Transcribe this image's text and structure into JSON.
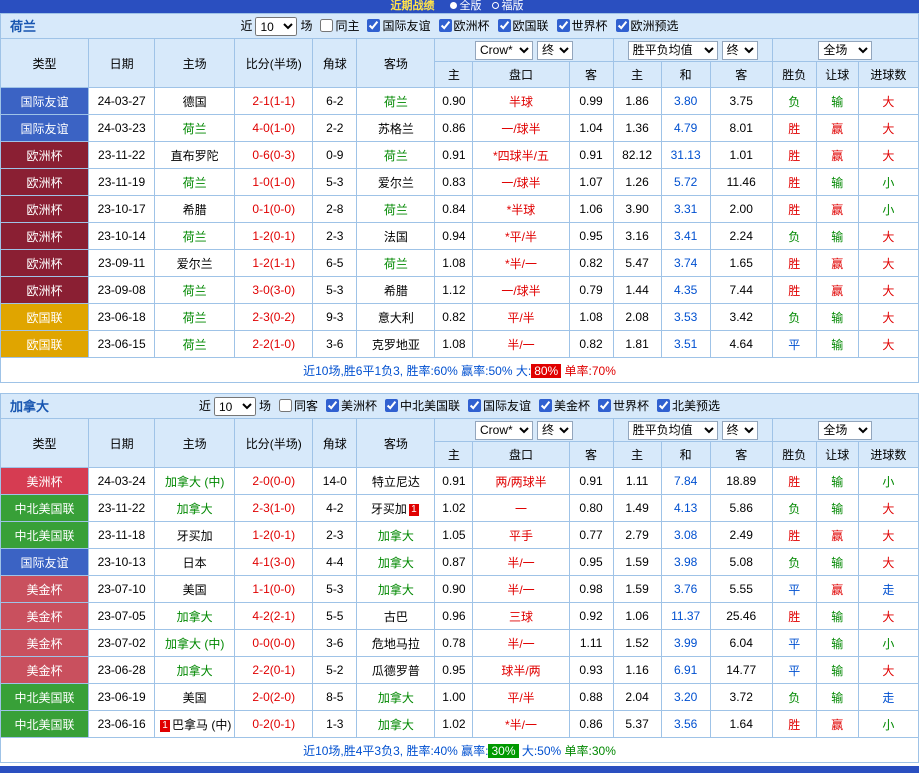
{
  "topbar": {
    "title": "近期战绩",
    "options": [
      {
        "label": "全版",
        "selected": true
      },
      {
        "label": "福版",
        "selected": false
      }
    ]
  },
  "table_head": {
    "type": "类型",
    "date": "日期",
    "home": "主场",
    "score": "比分(半场)",
    "corner": "角球",
    "away": "客场",
    "odds_company": "Crow*",
    "final": "终",
    "avg": "胜平负均值",
    "scope": "全场",
    "sub": [
      "主",
      "盘口",
      "客",
      "主",
      "和",
      "客",
      "胜负",
      "让球",
      "进球数"
    ]
  },
  "type_colors": {
    "国际友谊": "#3b63c4",
    "欧洲杯": "#8a1f33",
    "欧国联": "#e0a500",
    "美洲杯": "#d63c52",
    "中北美国联": "#38a038",
    "美金杯": "#c9505e"
  },
  "sections": [
    {
      "team": "荷兰",
      "filter": {
        "near": "近",
        "count": "10",
        "games": "场",
        "same": {
          "label": "同主",
          "checked": false
        },
        "leagues": [
          {
            "label": "国际友谊",
            "checked": true
          },
          {
            "label": "欧洲杯",
            "checked": true
          },
          {
            "label": "欧国联",
            "checked": true
          },
          {
            "label": "世界杯",
            "checked": true
          },
          {
            "label": "欧洲预选",
            "checked": true
          }
        ]
      },
      "rows": [
        {
          "type": "国际友谊",
          "date": "24-03-27",
          "home": "德国",
          "score": "2-1(1-1)",
          "corner": "6-2",
          "away": "荷兰",
          "away_g": true,
          "o1": "0.90",
          "pan": "半球",
          "o2": "0.99",
          "a1": "1.86",
          "ad": "3.80",
          "a2": "3.75",
          "res": "负",
          "res_c": "g",
          "let": "输",
          "let_c": "g",
          "goal": "大",
          "goal_c": "r"
        },
        {
          "type": "国际友谊",
          "date": "24-03-23",
          "home": "荷兰",
          "home_g": true,
          "score": "4-0(1-0)",
          "corner": "2-2",
          "away": "苏格兰",
          "o1": "0.86",
          "pan": "一/球半",
          "o2": "1.04",
          "a1": "1.36",
          "ad": "4.79",
          "a2": "8.01",
          "res": "胜",
          "res_c": "r",
          "let": "赢",
          "let_c": "r",
          "goal": "大",
          "goal_c": "r"
        },
        {
          "type": "欧洲杯",
          "date": "23-11-22",
          "home": "直布罗陀",
          "score": "0-6(0-3)",
          "corner": "0-9",
          "away": "荷兰",
          "away_g": true,
          "o1": "0.91",
          "pan": "*四球半/五",
          "o2": "0.91",
          "a1": "82.12",
          "ad": "31.13",
          "a2": "1.01",
          "res": "胜",
          "res_c": "r",
          "let": "赢",
          "let_c": "r",
          "goal": "大",
          "goal_c": "r"
        },
        {
          "type": "欧洲杯",
          "date": "23-11-19",
          "home": "荷兰",
          "home_g": true,
          "score": "1-0(1-0)",
          "corner": "5-3",
          "away": "爱尔兰",
          "o1": "0.83",
          "pan": "一/球半",
          "o2": "1.07",
          "a1": "1.26",
          "ad": "5.72",
          "a2": "11.46",
          "res": "胜",
          "res_c": "r",
          "let": "输",
          "let_c": "g",
          "goal": "小",
          "goal_c": "g"
        },
        {
          "type": "欧洲杯",
          "date": "23-10-17",
          "home": "希腊",
          "score": "0-1(0-0)",
          "corner": "2-8",
          "away": "荷兰",
          "away_g": true,
          "o1": "0.84",
          "pan": "*半球",
          "o2": "1.06",
          "a1": "3.90",
          "ad": "3.31",
          "a2": "2.00",
          "res": "胜",
          "res_c": "r",
          "let": "赢",
          "let_c": "r",
          "goal": "小",
          "goal_c": "g"
        },
        {
          "type": "欧洲杯",
          "date": "23-10-14",
          "home": "荷兰",
          "home_g": true,
          "score": "1-2(0-1)",
          "corner": "2-3",
          "away": "法国",
          "o1": "0.94",
          "pan": "*平/半",
          "o2": "0.95",
          "a1": "3.16",
          "ad": "3.41",
          "a2": "2.24",
          "res": "负",
          "res_c": "g",
          "let": "输",
          "let_c": "g",
          "goal": "大",
          "goal_c": "r"
        },
        {
          "type": "欧洲杯",
          "date": "23-09-11",
          "home": "爱尔兰",
          "score": "1-2(1-1)",
          "corner": "6-5",
          "away": "荷兰",
          "away_g": true,
          "o1": "1.08",
          "pan": "*半/一",
          "o2": "0.82",
          "a1": "5.47",
          "ad": "3.74",
          "a2": "1.65",
          "res": "胜",
          "res_c": "r",
          "let": "赢",
          "let_c": "r",
          "goal": "大",
          "goal_c": "r"
        },
        {
          "type": "欧洲杯",
          "date": "23-09-08",
          "home": "荷兰",
          "home_g": true,
          "score": "3-0(3-0)",
          "corner": "5-3",
          "away": "希腊",
          "o1": "1.12",
          "pan": "一/球半",
          "o2": "0.79",
          "a1": "1.44",
          "ad": "4.35",
          "a2": "7.44",
          "res": "胜",
          "res_c": "r",
          "let": "赢",
          "let_c": "r",
          "goal": "大",
          "goal_c": "r"
        },
        {
          "type": "欧国联",
          "date": "23-06-18",
          "home": "荷兰",
          "home_g": true,
          "score": "2-3(0-2)",
          "corner": "9-3",
          "away": "意大利",
          "o1": "0.82",
          "pan": "平/半",
          "o2": "1.08",
          "a1": "2.08",
          "ad": "3.53",
          "a2": "3.42",
          "res": "负",
          "res_c": "g",
          "let": "输",
          "let_c": "g",
          "goal": "大",
          "goal_c": "r"
        },
        {
          "type": "欧国联",
          "date": "23-06-15",
          "home": "荷兰",
          "home_g": true,
          "score": "2-2(1-0)",
          "corner": "3-6",
          "away": "克罗地亚",
          "o1": "1.08",
          "pan": "半/一",
          "o2": "0.82",
          "a1": "1.81",
          "ad": "3.51",
          "a2": "4.64",
          "res": "平",
          "res_c": "b",
          "let": "输",
          "let_c": "g",
          "goal": "大",
          "goal_c": "r"
        }
      ],
      "summary": [
        {
          "t": "近10场,胜6平1负3, 胜率:60% ",
          "c": "b"
        },
        {
          "t": "赢率:50% ",
          "c": "b"
        },
        {
          "t": "大:",
          "c": "b"
        },
        {
          "t": "80%",
          "c": "hlr"
        },
        {
          "t": " 单率:70%",
          "c": "r"
        }
      ]
    },
    {
      "team": "加拿大",
      "filter": {
        "near": "近",
        "count": "10",
        "games": "场",
        "same": {
          "label": "同客",
          "checked": false
        },
        "leagues": [
          {
            "label": "美洲杯",
            "checked": true
          },
          {
            "label": "中北美国联",
            "checked": true
          },
          {
            "label": "国际友谊",
            "checked": true
          },
          {
            "label": "美金杯",
            "checked": true
          },
          {
            "label": "世界杯",
            "checked": true
          },
          {
            "label": "北美预选",
            "checked": true
          }
        ]
      },
      "rows": [
        {
          "type": "美洲杯",
          "date": "24-03-24",
          "home": "加拿大 (中)",
          "home_g": true,
          "score": "2-0(0-0)",
          "corner": "14-0",
          "away": "特立尼达",
          "o1": "0.91",
          "pan": "两/两球半",
          "o2": "0.91",
          "a1": "1.11",
          "ad": "7.84",
          "a2": "18.89",
          "res": "胜",
          "res_c": "r",
          "let": "输",
          "let_c": "g",
          "goal": "小",
          "goal_c": "g"
        },
        {
          "type": "中北美国联",
          "date": "23-11-22",
          "home": "加拿大",
          "home_g": true,
          "score": "2-3(1-0)",
          "corner": "4-2",
          "away": "牙买加",
          "away_bpost": "1",
          "o1": "1.02",
          "pan": "一",
          "o2": "0.80",
          "a1": "1.49",
          "ad": "4.13",
          "a2": "5.86",
          "res": "负",
          "res_c": "g",
          "let": "输",
          "let_c": "g",
          "goal": "大",
          "goal_c": "r"
        },
        {
          "type": "中北美国联",
          "date": "23-11-18",
          "home": "牙买加",
          "score": "1-2(0-1)",
          "corner": "2-3",
          "away": "加拿大",
          "away_g": true,
          "o1": "1.05",
          "pan": "平手",
          "o2": "0.77",
          "a1": "2.79",
          "ad": "3.08",
          "a2": "2.49",
          "res": "胜",
          "res_c": "r",
          "let": "赢",
          "let_c": "r",
          "goal": "大",
          "goal_c": "r"
        },
        {
          "type": "国际友谊",
          "date": "23-10-13",
          "home": "日本",
          "score": "4-1(3-0)",
          "corner": "4-4",
          "away": "加拿大",
          "away_g": true,
          "o1": "0.87",
          "pan": "半/一",
          "o2": "0.95",
          "a1": "1.59",
          "ad": "3.98",
          "a2": "5.08",
          "res": "负",
          "res_c": "g",
          "let": "输",
          "let_c": "g",
          "goal": "大",
          "goal_c": "r"
        },
        {
          "type": "美金杯",
          "date": "23-07-10",
          "home": "美国",
          "score": "1-1(0-0)",
          "corner": "5-3",
          "away": "加拿大",
          "away_g": true,
          "o1": "0.90",
          "pan": "半/一",
          "o2": "0.98",
          "a1": "1.59",
          "ad": "3.76",
          "a2": "5.55",
          "res": "平",
          "res_c": "b",
          "let": "赢",
          "let_c": "r",
          "goal": "走",
          "goal_c": "b"
        },
        {
          "type": "美金杯",
          "date": "23-07-05",
          "home": "加拿大",
          "home_g": true,
          "score": "4-2(2-1)",
          "corner": "5-5",
          "away": "古巴",
          "o1": "0.96",
          "pan": "三球",
          "o2": "0.92",
          "a1": "1.06",
          "ad": "11.37",
          "a2": "25.46",
          "res": "胜",
          "res_c": "r",
          "let": "输",
          "let_c": "g",
          "goal": "大",
          "goal_c": "r"
        },
        {
          "type": "美金杯",
          "date": "23-07-02",
          "home": "加拿大 (中)",
          "home_g": true,
          "score": "0-0(0-0)",
          "corner": "3-6",
          "away": "危地马拉",
          "o1": "0.78",
          "pan": "半/一",
          "o2": "1.11",
          "a1": "1.52",
          "ad": "3.99",
          "a2": "6.04",
          "res": "平",
          "res_c": "b",
          "let": "输",
          "let_c": "g",
          "goal": "小",
          "goal_c": "g"
        },
        {
          "type": "美金杯",
          "date": "23-06-28",
          "home": "加拿大",
          "home_g": true,
          "score": "2-2(0-1)",
          "corner": "5-2",
          "away": "瓜德罗普",
          "o1": "0.95",
          "pan": "球半/两",
          "o2": "0.93",
          "a1": "1.16",
          "ad": "6.91",
          "a2": "14.77",
          "res": "平",
          "res_c": "b",
          "let": "输",
          "let_c": "g",
          "goal": "大",
          "goal_c": "r"
        },
        {
          "type": "中北美国联",
          "date": "23-06-19",
          "home": "美国",
          "score": "2-0(2-0)",
          "corner": "8-5",
          "away": "加拿大",
          "away_g": true,
          "o1": "1.00",
          "pan": "平/半",
          "o2": "0.88",
          "a1": "2.04",
          "ad": "3.20",
          "a2": "3.72",
          "res": "负",
          "res_c": "g",
          "let": "输",
          "let_c": "g",
          "goal": "走",
          "goal_c": "b"
        },
        {
          "type": "中北美国联",
          "date": "23-06-16",
          "home": "巴拿马 (中)",
          "home_bpre": "1",
          "score": "0-2(0-1)",
          "corner": "1-3",
          "away": "加拿大",
          "away_g": true,
          "o1": "1.02",
          "pan": "*半/一",
          "o2": "0.86",
          "a1": "5.37",
          "ad": "3.56",
          "a2": "1.64",
          "res": "胜",
          "res_c": "r",
          "let": "赢",
          "let_c": "r",
          "goal": "小",
          "goal_c": "g"
        }
      ],
      "summary": [
        {
          "t": "近10场,胜4平3负3, 胜率:40% ",
          "c": "b"
        },
        {
          "t": "赢率:",
          "c": "b"
        },
        {
          "t": "30%",
          "c": "hlg"
        },
        {
          "t": " 大:50% ",
          "c": "b"
        },
        {
          "t": "单率:30%",
          "c": "g"
        }
      ]
    }
  ]
}
